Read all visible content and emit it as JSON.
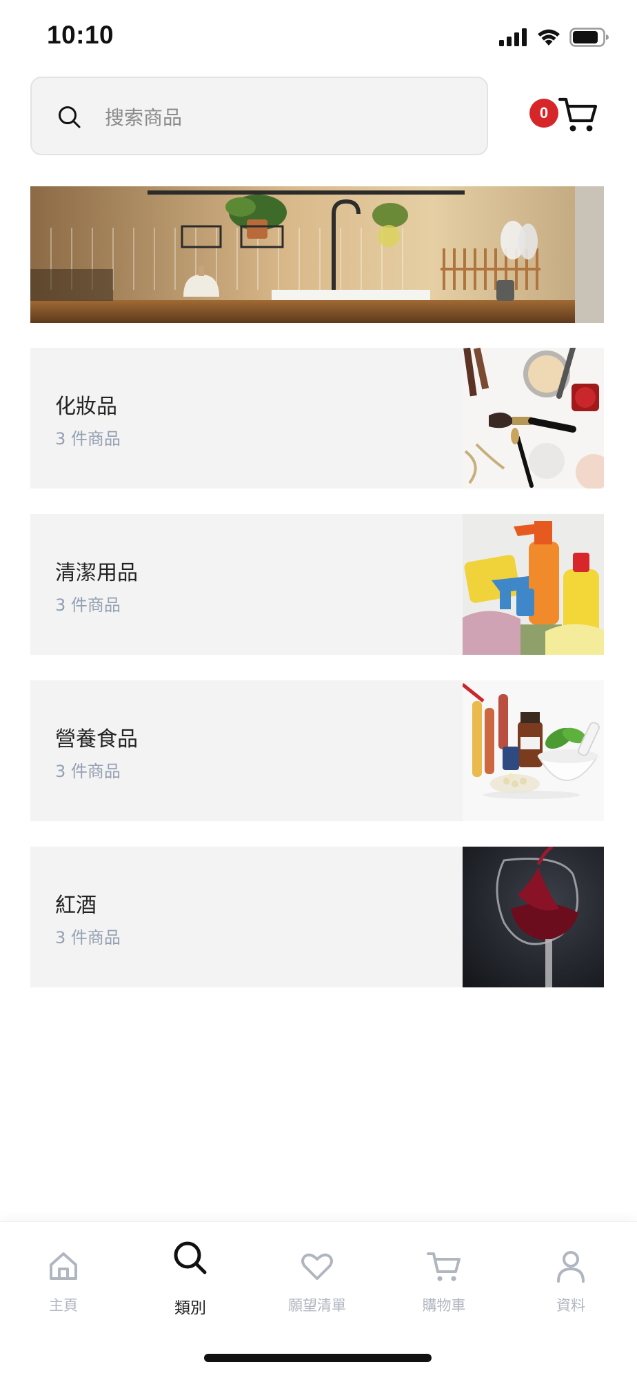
{
  "status_bar": {
    "time": "10:10",
    "icons": [
      "signal-icon",
      "wifi-icon",
      "battery-icon"
    ]
  },
  "search": {
    "placeholder": "搜索商品",
    "value": ""
  },
  "cart": {
    "count": "0",
    "badge_color": "#d7262a"
  },
  "categories": [
    {
      "name": "化妝品",
      "count": "3 件商品",
      "image": "cosmetics"
    },
    {
      "name": "清潔用品",
      "count": "3 件商品",
      "image": "cleaning-supplies"
    },
    {
      "name": "營養食品",
      "count": "3 件商品",
      "image": "nutrition-supplements"
    },
    {
      "name": "紅酒",
      "count": "3 件商品",
      "image": "red-wine"
    }
  ],
  "bottom_nav": {
    "active": "類別",
    "items": [
      {
        "label": "主頁",
        "icon": "home-icon"
      },
      {
        "label": "類別",
        "icon": "search-icon"
      },
      {
        "label": "願望清單",
        "icon": "heart-icon"
      },
      {
        "label": "購物車",
        "icon": "cart-icon"
      },
      {
        "label": "資料",
        "icon": "user-icon"
      }
    ]
  },
  "colors": {
    "card_bg": "#f3f3f3",
    "muted_text": "#94a0b2",
    "nav_inactive": "#b0b6c0",
    "nav_active": "#222222"
  }
}
